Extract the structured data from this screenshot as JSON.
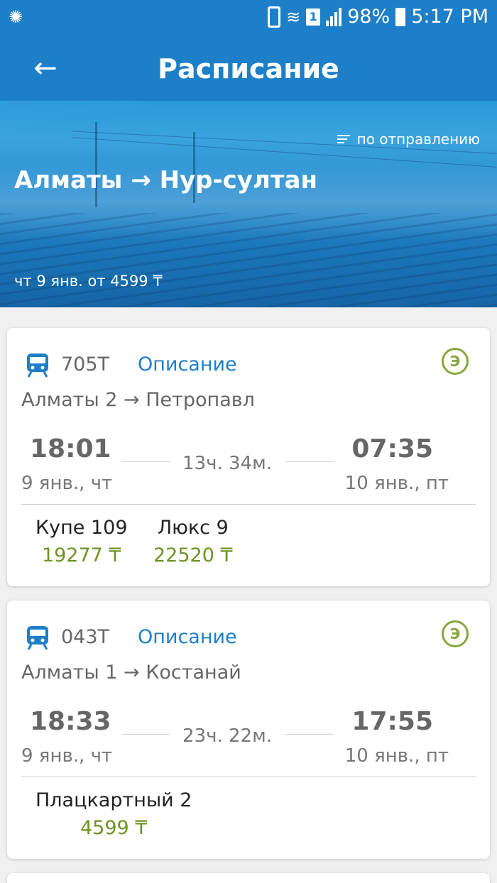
{
  "status_bar": {
    "battery": "98%",
    "time": "5:17 PM",
    "sim": "1"
  },
  "app_bar": {
    "title": "Расписание"
  },
  "header": {
    "sort_label": "по отправлению",
    "route": "Алматы → Нур-султан",
    "subtitle": "чт 9 янв. от 4599 ₸"
  },
  "trains": [
    {
      "number": "705Т",
      "description_link": "Описание",
      "eco_badge": "Э",
      "route": "Алматы 2 → Петропавл",
      "departure_time": "18:01",
      "departure_date": "9 янв., чт",
      "duration": "13ч. 34м.",
      "arrival_time": "07:35",
      "arrival_date": "10 янв., пт",
      "seats": [
        {
          "name": "Купе 109",
          "price": "19277 ₸"
        },
        {
          "name": "Люкс 9",
          "price": "22520 ₸"
        }
      ]
    },
    {
      "number": "043Т",
      "description_link": "Описание",
      "eco_badge": "Э",
      "route": "Алматы 1 → Костанай",
      "departure_time": "18:33",
      "departure_date": "9 янв., чт",
      "duration": "23ч. 22м.",
      "arrival_time": "17:55",
      "arrival_date": "10 янв., пт",
      "seats": [
        {
          "name": "Плацкартный 2",
          "price": "4599 ₸"
        }
      ]
    }
  ]
}
